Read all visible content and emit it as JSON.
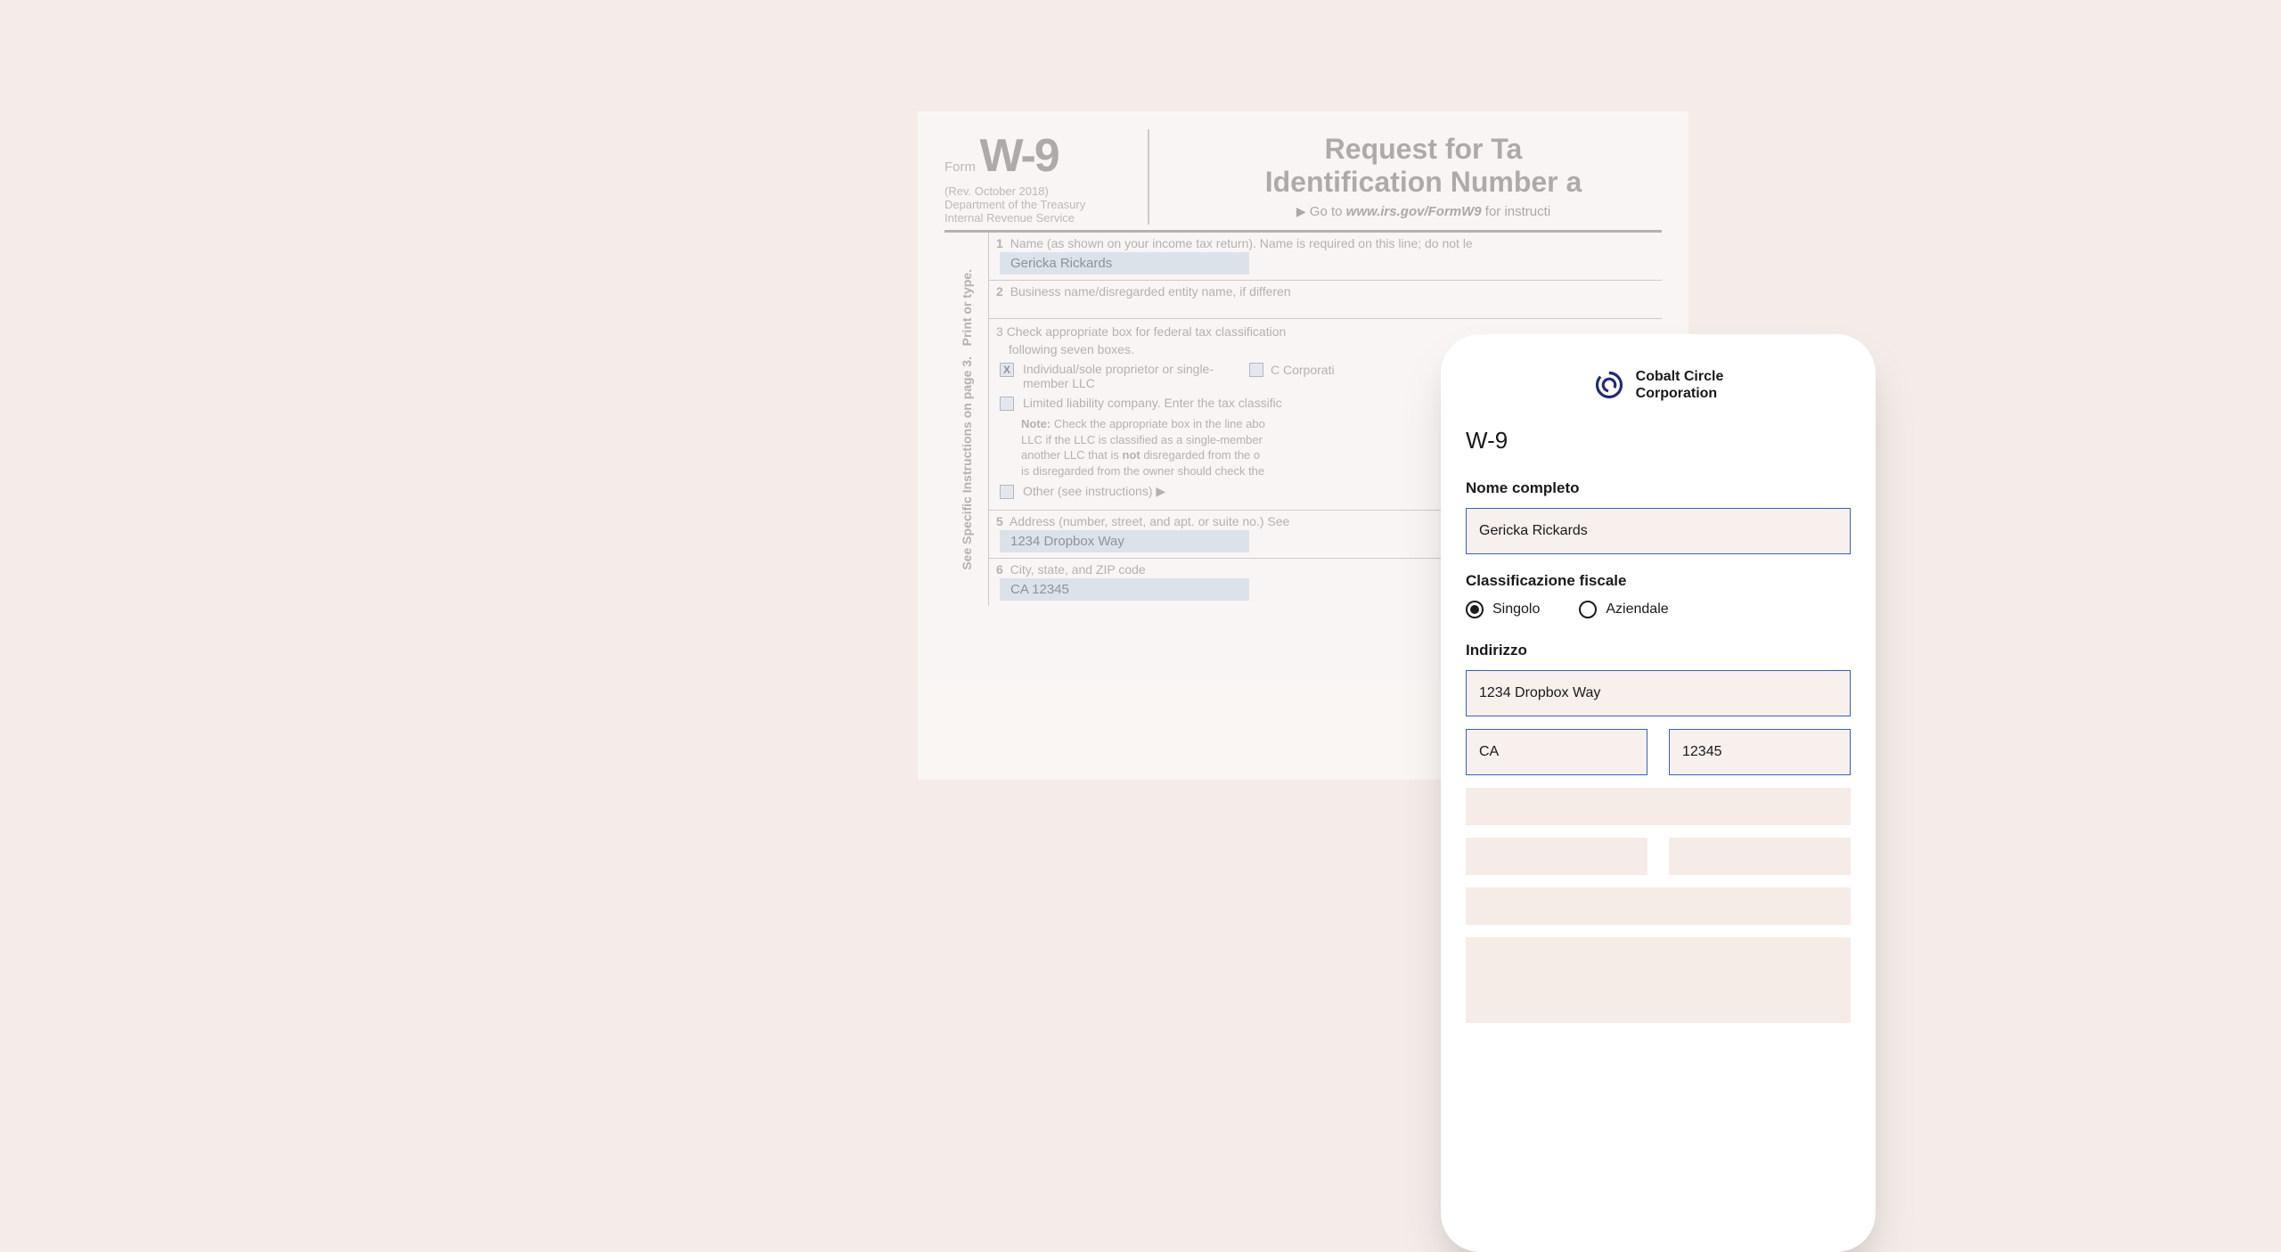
{
  "w9": {
    "form_word": "Form",
    "code": "W-9",
    "rev": "(Rev. October 2018)",
    "dept": "Department of the Treasury",
    "irs": "Internal Revenue Service",
    "title_line1": "Request for Ta",
    "title_line2": "Identification Number a",
    "goto_prefix": "Go to",
    "goto_url": "www.irs.gov/FormW9",
    "goto_suffix": "for instructi",
    "side_text": "Print or type.",
    "side_text2": "See Specific Instructions on page 3.",
    "row1": {
      "num": "1",
      "instr": "Name (as shown on your income tax return). Name is required on this line; do not le",
      "value": "Gericka Rickards"
    },
    "row2": {
      "num": "2",
      "instr": "Business name/disregarded entity name, if differen"
    },
    "row3": {
      "num": "3",
      "line1": "Check appropriate box for federal tax classification",
      "line2": "following seven boxes.",
      "individual": "Individual/sole proprietor or single-member LLC",
      "ccorp": "C Corporati",
      "llc": "Limited liability company. Enter the tax classific",
      "note": "Check the appropriate box in the line abo",
      "note2": "LLC if the LLC is classified as a single-member",
      "note3": "another LLC that is",
      "note_not": "not",
      "note4": "disregarded from the o",
      "note5": "is disregarded from the owner should check the",
      "other": "Other (see instructions) ▶"
    },
    "row5": {
      "num": "5",
      "instr": "Address (number, street, and apt. or suite no.) See",
      "value": "1234 Dropbox Way"
    },
    "row6": {
      "num": "6",
      "instr": "City, state, and ZIP code",
      "value": "CA 12345"
    }
  },
  "mobile": {
    "company": {
      "line1": "Cobalt Circle",
      "line2": "Corporation"
    },
    "title": "W-9",
    "full_name_label": "Nome completo",
    "full_name_value": "Gericka Rickards",
    "tax_class_label": "Classificazione fiscale",
    "radio_single": "Singolo",
    "radio_business": "Aziendale",
    "address_label": "Indirizzo",
    "address_street": "1234 Dropbox Way",
    "address_state": "CA",
    "address_zip": "12345"
  }
}
